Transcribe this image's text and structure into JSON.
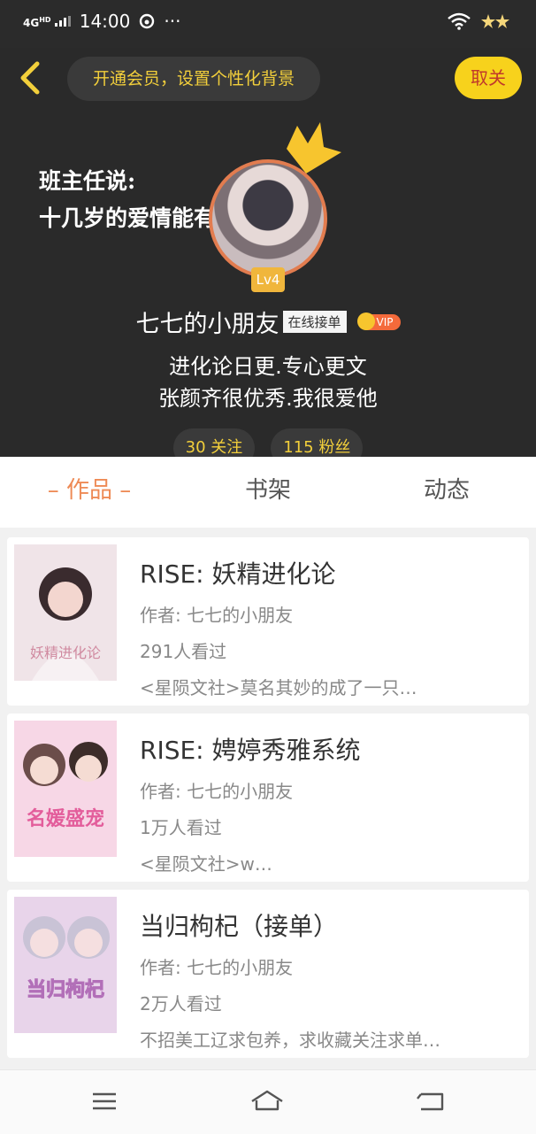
{
  "status_bar": {
    "network": "4G",
    "network_sup": "HD",
    "time": "14:00",
    "more": "···"
  },
  "header": {
    "vip_prompt": "开通会员，设置个性化背景",
    "unfollow_label": "取关"
  },
  "profile": {
    "background_quote": "班主任说:\n十几岁的爱情能有多",
    "level": "Lv4",
    "nickname": "七七的小朋友",
    "tag": "在线接单",
    "vip_label": "VIP",
    "bio": [
      "进化论日更.专心更文",
      "张颜齐很优秀.我很爱他"
    ],
    "following": "30 关注",
    "followers": "115 粉丝"
  },
  "tabs": [
    {
      "label": "– 作品 –",
      "active": true
    },
    {
      "label": "书架",
      "active": false
    },
    {
      "label": "动态",
      "active": false
    }
  ],
  "books": [
    {
      "title": "RISE:  妖精进化论",
      "author": "作者: 七七的小朋友",
      "views": "291人看过",
      "desc": "<星陨文社>莫名其妙的成了一只…",
      "cover_text": "妖精进化论",
      "cover_color": "#f0e4e8"
    },
    {
      "title": "RISE:  娉婷秀雅系统",
      "author": "作者: 七七的小朋友",
      "views": "1万人看过",
      "desc": "<星陨文社>w…",
      "cover_text": "名媛盛宠",
      "cover_color": "#f7d7e6"
    },
    {
      "title": "当归枸杞（接单）",
      "author": "作者: 七七的小朋友",
      "views": "2万人看过",
      "desc": "不招美工辽求包养，求收藏关注求单…",
      "cover_text": "当归枸杞",
      "cover_color": "#e8d4ea"
    }
  ],
  "accent_color": "#ee8a55"
}
